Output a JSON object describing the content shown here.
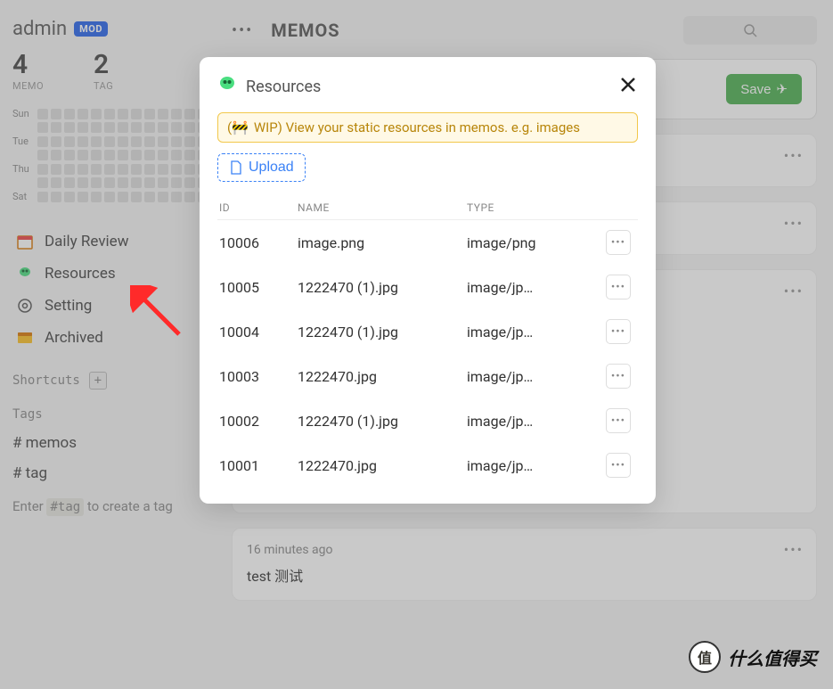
{
  "user": {
    "name": "admin",
    "badge": "MOD"
  },
  "stats": {
    "memo_count": "4",
    "memo_label": "MEMO",
    "tag_count": "2",
    "tag_label": "TAG"
  },
  "calendar_days": [
    "Sun",
    "Tue",
    "Thu",
    "Sat"
  ],
  "nav": {
    "daily_review": "Daily Review",
    "resources": "Resources",
    "setting": "Setting",
    "archived": "Archived"
  },
  "shortcuts": {
    "label": "Shortcuts"
  },
  "tags": {
    "label": "Tags",
    "items": [
      "# memos",
      "# tag"
    ],
    "hint_prefix": "Enter ",
    "hint_code": "#tag",
    "hint_suffix": " to create a tag"
  },
  "header": {
    "title": "MEMOS"
  },
  "composer": {
    "save": "Save"
  },
  "memos": [
    {
      "time": "",
      "text": ""
    },
    {
      "time": "",
      "text": ""
    },
    {
      "time": "",
      "text": ""
    },
    {
      "time": "16 minutes ago",
      "text": "test 测试"
    }
  ],
  "modal": {
    "title": "Resources",
    "wip": "WIP) View your static resources in memos. e.g. images",
    "upload": "Upload",
    "columns": {
      "id": "ID",
      "name": "NAME",
      "type": "TYPE"
    },
    "rows": [
      {
        "id": "10006",
        "name": "image.png",
        "type": "image/png"
      },
      {
        "id": "10005",
        "name": "1222470 (1).jpg",
        "type": "image/jp…"
      },
      {
        "id": "10004",
        "name": "1222470 (1).jpg",
        "type": "image/jp…"
      },
      {
        "id": "10003",
        "name": "1222470.jpg",
        "type": "image/jp…"
      },
      {
        "id": "10002",
        "name": "1222470 (1).jpg",
        "type": "image/jp…"
      },
      {
        "id": "10001",
        "name": "1222470.jpg",
        "type": "image/jp…"
      }
    ]
  },
  "float": {
    "circle": "值",
    "text": "什么值得买"
  }
}
